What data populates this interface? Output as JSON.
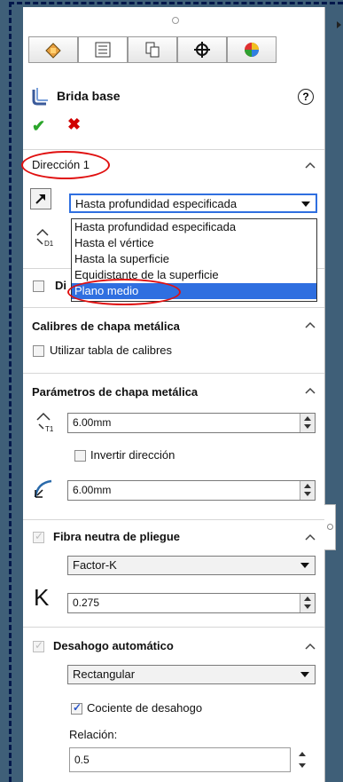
{
  "feature": {
    "title": "Brida base",
    "help": "?"
  },
  "actions": {
    "ok": "✔",
    "cancel": "✖"
  },
  "direction1": {
    "title": "Dirección 1",
    "end_condition": "Hasta profundidad especificada",
    "options": [
      "Hasta profundidad especificada",
      "Hasta el vértice",
      "Hasta la superficie",
      "Equidistante de la superficie",
      "Plano medio"
    ],
    "highlighted_option": "Plano medio"
  },
  "direction2": {
    "label_partial": "Di"
  },
  "gauges": {
    "title": "Calibres de chapa metálica",
    "use_table": "Utilizar tabla de calibres"
  },
  "params": {
    "title": "Parámetros de chapa metálica",
    "thickness": "6.00mm",
    "reverse": "Invertir dirección",
    "radius": "6.00mm"
  },
  "bend": {
    "title": "Fibra neutra de pliegue",
    "type": "Factor-K",
    "k_symbol": "K",
    "k_value": "0.275"
  },
  "relief": {
    "title": "Desahogo automático",
    "type": "Rectangular",
    "ratio_check": "Cociente de desahogo",
    "ratio_label": "Relación:",
    "ratio_value": "0.5"
  },
  "colors": {
    "highlight": "#2f6fe0",
    "annotation": "#e01010",
    "frame": "#00174a"
  }
}
